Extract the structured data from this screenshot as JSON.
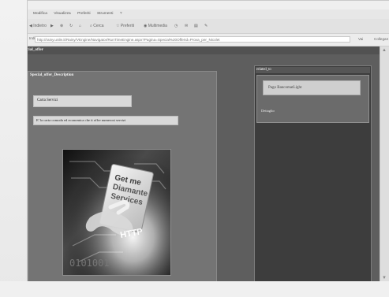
{
  "browser": {
    "menu": [
      "Modifica",
      "Visualizza",
      "Preferiti",
      "Strumenti",
      "?"
    ],
    "toolbar": {
      "back": "Indietro",
      "search": "Cerca",
      "favorites": "Preferiti",
      "media": "Multimedia"
    },
    "address": {
      "label": "Indirizzo",
      "url": "http://rainy.unile.it/Rainy/VEngine/Navigator/RunTimeEngine.aspx?Pagina=Special%20OfferId=Prova_per_Nicolet",
      "go": "Vai",
      "links": "Collegamenti"
    }
  },
  "page": {
    "title": "cial_offer",
    "left_panel": {
      "header": "Special_offer_Description",
      "field_one": "Carta Servizi",
      "field_two": "E' la carta comoda ed economica che ti offre numerosi servizi"
    },
    "right_panel": {
      "header": "related_to",
      "card_link": "Pago BancomatLight",
      "meta": "Dettaglio"
    },
    "image_text": {
      "line1": "Get me",
      "line2": "Diamante",
      "line3": "Services",
      "line4": "HTTP",
      "binary": "0101001"
    }
  },
  "colors": {
    "content_background": "#5e5e5e",
    "left_panel": "#747474",
    "right_panel": "#3d3d3d",
    "text_light": "#f1f1f1"
  },
  "icons": {
    "back": "back-arrow-icon",
    "forward": "forward-arrow-icon",
    "stop": "stop-icon",
    "refresh": "refresh-icon",
    "home": "home-icon",
    "search": "search-icon",
    "favorites": "star-icon",
    "media": "media-icon",
    "history": "history-icon",
    "mail": "mail-icon",
    "print": "print-icon",
    "edit": "edit-icon"
  }
}
